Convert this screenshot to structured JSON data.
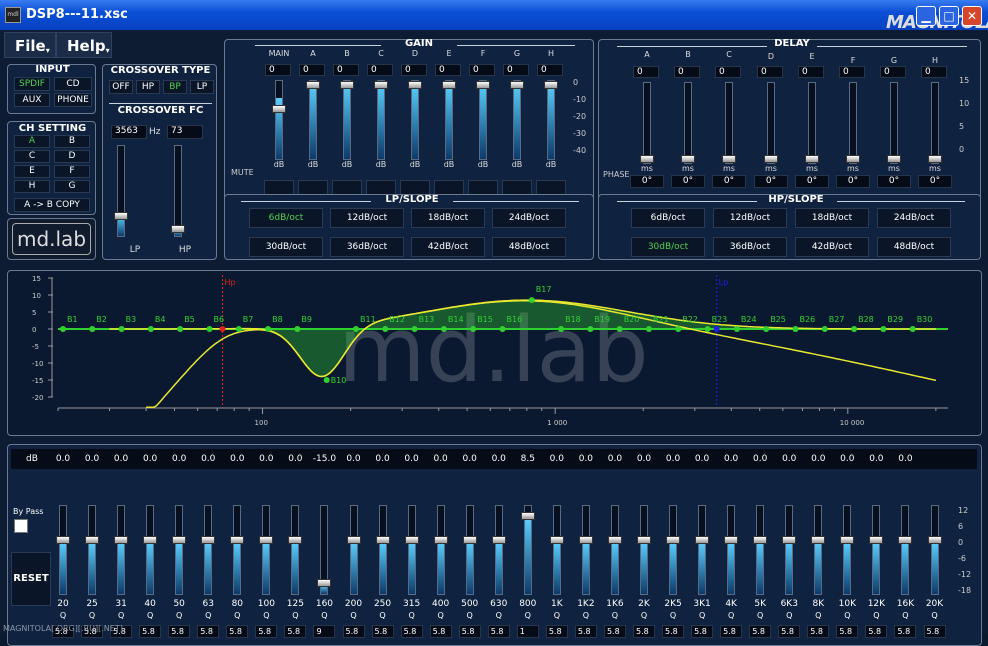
{
  "window": {
    "title": "DSP8---11.xsc",
    "watermark": "MAGNITOLA"
  },
  "menu": {
    "file": "File",
    "help": "Help"
  },
  "input": {
    "title": "INPUT",
    "buttons": [
      "SPDIF",
      "CD",
      "AUX",
      "PHONE"
    ],
    "active": "SPDIF"
  },
  "ch_setting": {
    "title": "CH SETTING",
    "buttons": [
      "A",
      "B",
      "C",
      "D",
      "E",
      "F",
      "H",
      "G"
    ],
    "active": "A",
    "copy": "A -> B COPY"
  },
  "logo": "md.lab",
  "crossover": {
    "type_title": "CROSSOVER TYPE",
    "types": [
      "OFF",
      "HP",
      "BP",
      "LP"
    ],
    "active": "BP",
    "fc_title": "CROSSOVER FC",
    "lp_value": "3563",
    "hz": "Hz",
    "hp_value": "73",
    "lp_label": "LP",
    "hp_label": "HP",
    "lp_level": 0.22,
    "hp_level": 0.08
  },
  "gain": {
    "title": "GAIN",
    "channels": [
      "MAIN",
      "A",
      "B",
      "C",
      "D",
      "E",
      "F",
      "G",
      "H"
    ],
    "values": [
      "0",
      "0",
      "0",
      "0",
      "0",
      "0",
      "0",
      "0",
      "0"
    ],
    "unit": "dB",
    "mute": "MUTE",
    "scale": [
      "0",
      "-10",
      "-20",
      "-30",
      "-40"
    ],
    "levels": [
      0.8,
      1,
      1,
      1,
      1,
      1,
      1,
      1,
      1
    ]
  },
  "delay": {
    "title": "DELAY",
    "channels": [
      "A",
      "B",
      "C",
      "D",
      "E",
      "F",
      "G",
      "H"
    ],
    "values": [
      "0",
      "0",
      "0",
      "0",
      "0",
      "0",
      "0",
      "0"
    ],
    "unit": "ms",
    "phase": "PHASE",
    "phase_values": [
      "0°",
      "0°",
      "0°",
      "0°",
      "0°",
      "0°",
      "0°",
      "0°"
    ],
    "scale": [
      "15",
      "10",
      "5",
      "0"
    ]
  },
  "lp_slope": {
    "title": "LP/SLOPE",
    "options": [
      "6dB/oct",
      "12dB/oct",
      "18dB/oct",
      "24dB/oct",
      "30dB/oct",
      "36dB/oct",
      "42dB/oct",
      "48dB/oct"
    ],
    "active": "6dB/oct"
  },
  "hp_slope": {
    "title": "HP/SLOPE",
    "options": [
      "6dB/oct",
      "12dB/oct",
      "18dB/oct",
      "24dB/oct",
      "30dB/oct",
      "36dB/oct",
      "42dB/oct",
      "48dB/oct"
    ],
    "active": "30dB/oct"
  },
  "graph": {
    "y_ticks": [
      "15",
      "10",
      "5",
      "0",
      "-5",
      "-10",
      "-15",
      "-20"
    ],
    "x_ticks": [
      "100",
      "1 000",
      "10 000"
    ],
    "hp_marker": "Hp",
    "lp_marker": "Lp",
    "bands": [
      "B1",
      "B2",
      "B3",
      "B4",
      "B5",
      "B6",
      "B7",
      "B8",
      "B9",
      "B10",
      "B11",
      "B12",
      "B13",
      "B14",
      "B15",
      "B16",
      "B17",
      "B18",
      "B19",
      "B20",
      "B21",
      "B22",
      "B23",
      "B24",
      "B25",
      "B26",
      "B27",
      "B28",
      "B29",
      "B30"
    ]
  },
  "eq": {
    "db_label": "dB",
    "bypass": "By Pass",
    "reset": "RESET",
    "q_label": "Q",
    "values": [
      "0.0",
      "0.0",
      "0.0",
      "0.0",
      "0.0",
      "0.0",
      "0.0",
      "0.0",
      "0.0",
      "-15.0",
      "0.0",
      "0.0",
      "0.0",
      "0.0",
      "0.0",
      "0.0",
      "8.5",
      "0.0",
      "0.0",
      "0.0",
      "0.0",
      "0.0",
      "0.0",
      "0.0",
      "0.0",
      "0.0",
      "0.0",
      "0.0",
      "0.0",
      "0.0"
    ],
    "freqs": [
      "20",
      "25",
      "31",
      "40",
      "50",
      "63",
      "80",
      "100",
      "125",
      "160",
      "200",
      "250",
      "315",
      "400",
      "500",
      "630",
      "800",
      "1K",
      "1K2",
      "1K6",
      "2K",
      "2K5",
      "3K1",
      "4K",
      "5K",
      "6K3",
      "8K",
      "10K",
      "12K",
      "16K",
      "20K"
    ],
    "q": [
      "5.8",
      "5.8",
      "5.8",
      "5.8",
      "5.8",
      "5.8",
      "5.8",
      "5.8",
      "5.8",
      "9",
      "5.8",
      "5.8",
      "5.8",
      "5.8",
      "5.8",
      "5.8",
      "1",
      "5.8",
      "5.8",
      "5.8",
      "5.8",
      "5.8",
      "5.8",
      "5.8",
      "5.8",
      "5.8",
      "5.8",
      "5.8",
      "5.8",
      "5.8",
      "5.8"
    ],
    "scale": [
      "12",
      "6",
      "0",
      "-6",
      "-12",
      "-18"
    ]
  },
  "footer": "MAGNITOLA[.ORG][.RU][.NET]",
  "colors": {
    "active_green": "#4ed04e",
    "curve_yellow": "#e8e830",
    "band_green": "#30d030"
  }
}
